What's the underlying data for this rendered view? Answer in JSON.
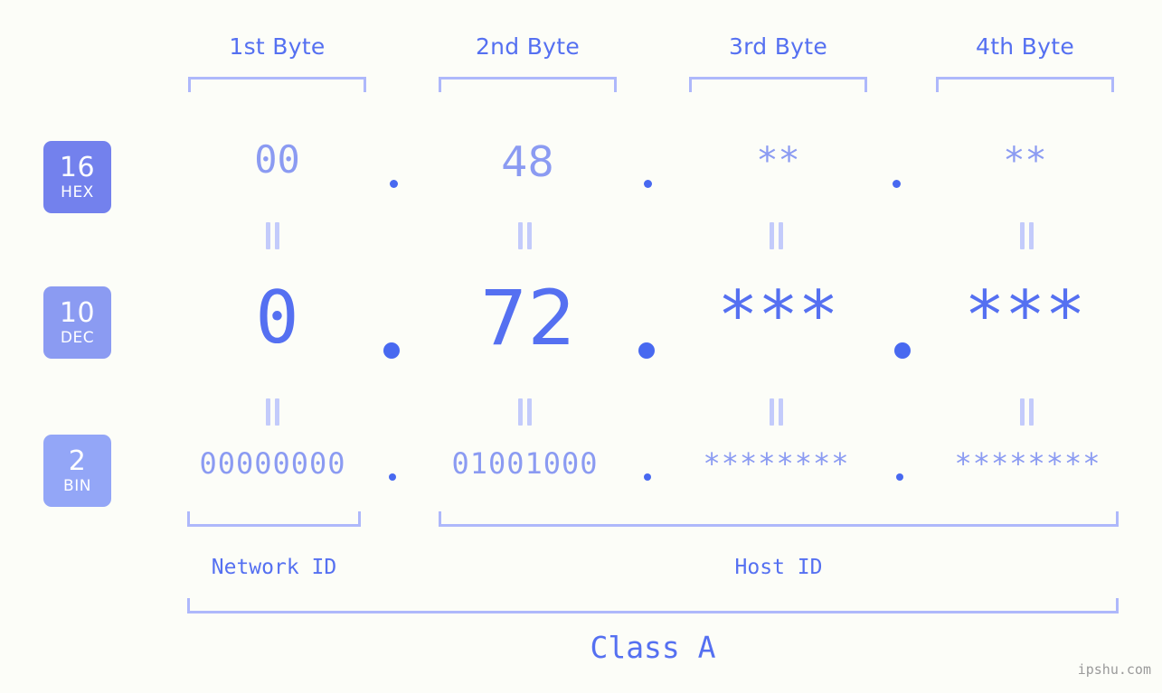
{
  "background_color": "#fcfdf8",
  "accent_color": "#5570f1",
  "accent_light": "#8b9bf2",
  "bracket_color": "#aeb8fb",
  "byte_headers": [
    {
      "label": "1st Byte"
    },
    {
      "label": "2nd Byte"
    },
    {
      "label": "3rd Byte"
    },
    {
      "label": "4th Byte"
    }
  ],
  "rows": {
    "hex": {
      "base_number": "16",
      "base_name": "HEX",
      "badge_color": "#7381ed",
      "values": [
        "00",
        "48",
        "**",
        "**"
      ],
      "separator": "."
    },
    "dec": {
      "base_number": "10",
      "base_name": "DEC",
      "badge_color": "#8b9bf2",
      "values": [
        "0",
        "72",
        "***",
        "***"
      ],
      "separator": "."
    },
    "bin": {
      "base_number": "2",
      "base_name": "BIN",
      "badge_color": "#93a6f7",
      "values": [
        "00000000",
        "01001000",
        "********",
        "********"
      ],
      "separator": "."
    }
  },
  "equals_connectors": "||",
  "sections": {
    "network_id": "Network ID",
    "host_id": "Host ID",
    "class": "Class A"
  },
  "watermark": "ipshu.com"
}
